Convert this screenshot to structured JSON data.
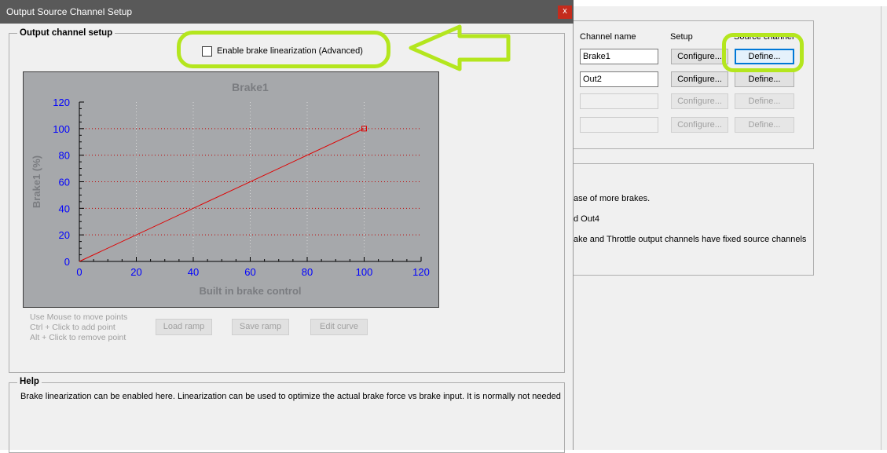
{
  "dialog": {
    "title": "Output Source Channel Setup",
    "close_label": "x"
  },
  "setup_group": {
    "title": "Output channel setup",
    "linearization_label": "Enable brake linearization (Advanced)",
    "linearization_checked": false
  },
  "chart_data": {
    "type": "line",
    "title": "Brake1",
    "xlabel": "Built in brake control",
    "ylabel": "Brake1 (%)",
    "xlim": [
      0,
      120
    ],
    "ylim": [
      0,
      120
    ],
    "xticks": [
      "0",
      "20",
      "40",
      "60",
      "80",
      "100",
      "120"
    ],
    "yticks": [
      "0",
      "20",
      "40",
      "60",
      "80",
      "100",
      "120"
    ],
    "grid": true,
    "series": [
      {
        "x": [
          0,
          100
        ],
        "y": [
          0,
          100
        ],
        "color": "#e00000",
        "markers_on_points": [
          [
            100,
            100
          ]
        ]
      }
    ]
  },
  "hints": {
    "line1": "Use Mouse to move points",
    "line2": "Ctrl + Click to add point",
    "line3": "Alt + Click to remove point"
  },
  "ramp_buttons": {
    "load": "Load ramp",
    "save": "Save ramp",
    "edit": "Edit curve"
  },
  "help": {
    "title": "Help",
    "text": "Brake linearization can be enabled here. Linearization can be used to optimize the actual brake force vs brake input. It is normally not needed"
  },
  "background_window": {
    "headers": {
      "channel_name": "Channel name",
      "setup": "Setup",
      "source_channel": "Source channel"
    },
    "rows": [
      {
        "name": "Brake1",
        "configure": "Configure...",
        "define": "Define...",
        "enabled": true,
        "focused": true
      },
      {
        "name": "Out2",
        "configure": "Configure...",
        "define": "Define...",
        "enabled": true,
        "focused": false
      },
      {
        "name": "",
        "configure": "Configure...",
        "define": "Define...",
        "enabled": false,
        "focused": false
      },
      {
        "name": "",
        "configure": "Configure...",
        "define": "Define...",
        "enabled": false,
        "focused": false
      }
    ],
    "info": {
      "line1": "ase of more brakes.",
      "line2": "d Out4",
      "line3": "ake and Throttle output channels have fixed source channels"
    }
  },
  "colors": {
    "highlight": "#b4e61e",
    "chart_bg": "#a6a8ab",
    "series": "#e00000",
    "axis_tick_labels_y": "#0000ff",
    "titlebar": "#595959"
  }
}
